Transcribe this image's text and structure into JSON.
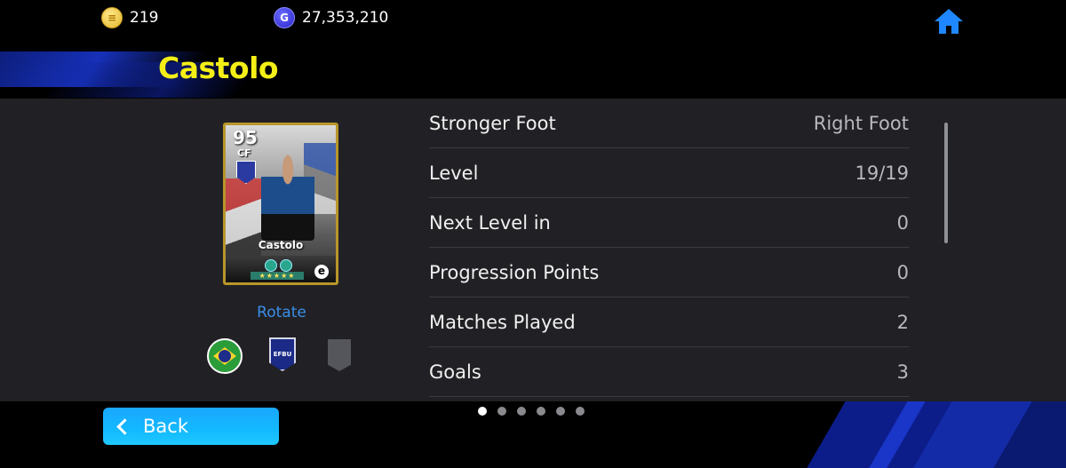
{
  "currency": {
    "coins_value": "219",
    "gp_value": "27,353,210",
    "coins_icon": "efootball-coin-icon",
    "gp_icon": "gp-icon"
  },
  "player": {
    "name": "Castolo",
    "card": {
      "rating": "95",
      "position": "CF",
      "card_name": "Castolo"
    },
    "rotate_label": "Rotate"
  },
  "stats": [
    {
      "label": "Stronger Foot",
      "value": "Right Foot"
    },
    {
      "label": "Level",
      "value": "19/19"
    },
    {
      "label": "Next Level in",
      "value": "0"
    },
    {
      "label": "Progression Points",
      "value": "0"
    },
    {
      "label": "Matches Played",
      "value": "2"
    },
    {
      "label": "Goals",
      "value": "3"
    }
  ],
  "footer": {
    "back_label": "Back",
    "pages_total": 6,
    "current_page": 1
  },
  "colors": {
    "name_yellow": "#f4ef16",
    "accent_blue": "#1aa7ff",
    "rotate_blue": "#3a8ee8",
    "panel_bg": "#212125"
  }
}
